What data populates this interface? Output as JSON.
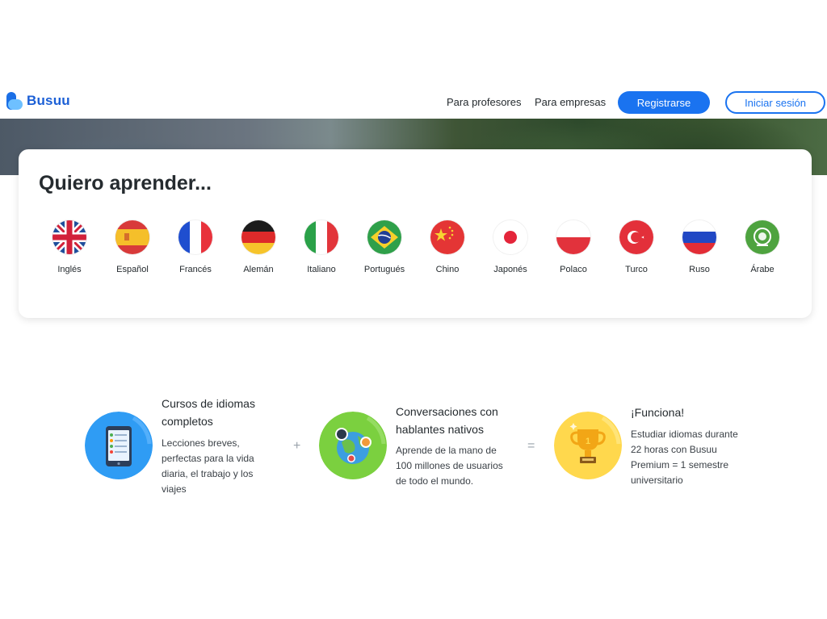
{
  "header": {
    "logo_text": "Busuu",
    "nav": {
      "teachers": "Para profesores",
      "companies": "Para empresas"
    },
    "register_label": "Registrarse",
    "login_label": "Iniciar sesión"
  },
  "card": {
    "title": "Quiero aprender...",
    "languages": [
      {
        "label": "Inglés",
        "flag": "uk-flag-icon"
      },
      {
        "label": "Español",
        "flag": "spain-flag-icon"
      },
      {
        "label": "Francés",
        "flag": "france-flag-icon"
      },
      {
        "label": "Alemán",
        "flag": "germany-flag-icon"
      },
      {
        "label": "Italiano",
        "flag": "italy-flag-icon"
      },
      {
        "label": "Portugués",
        "flag": "brazil-flag-icon"
      },
      {
        "label": "Chino",
        "flag": "china-flag-icon"
      },
      {
        "label": "Japonés",
        "flag": "japan-flag-icon"
      },
      {
        "label": "Polaco",
        "flag": "poland-flag-icon"
      },
      {
        "label": "Turco",
        "flag": "turkey-flag-icon"
      },
      {
        "label": "Ruso",
        "flag": "russia-flag-icon"
      },
      {
        "label": "Árabe",
        "flag": "arab-league-flag-icon"
      }
    ]
  },
  "features": [
    {
      "icon": "tablet-lessons-icon",
      "title_1": "Cursos de idiomas",
      "title_2": "completos",
      "desc_1": "Lecciones breves,",
      "desc_2": "perfectas para la vida",
      "desc_3": "diaria, el trabajo y los",
      "desc_4": "viajes"
    },
    {
      "icon": "globe-chat-icon",
      "title_1": "Conversaciones con",
      "title_2": "hablantes nativos",
      "desc_1": "Aprende de la mano de",
      "desc_2": "100 millones de usuarios",
      "desc_3": "de todo el mundo."
    },
    {
      "icon": "trophy-icon",
      "title_1": "¡Funciona!",
      "desc_1": "Estudiar idiomas durante",
      "desc_2": "22 horas con Busuu",
      "desc_3": "Premium = 1 semestre",
      "desc_4": "universitario"
    }
  ],
  "operators": {
    "plus": "+",
    "equals": "="
  },
  "colors": {
    "brand_blue": "#1a73f0",
    "logo_blue": "#1b5fd6",
    "text_dark": "#252b2f"
  }
}
